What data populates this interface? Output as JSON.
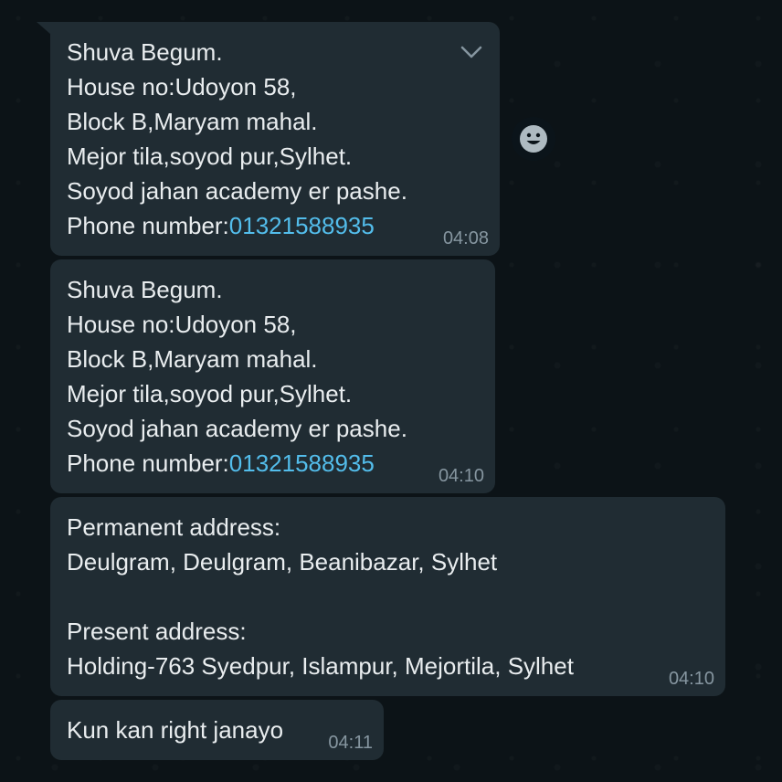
{
  "messages": [
    {
      "lines": [
        "Shuva Begum.",
        "House no:Udoyon 58,",
        "Block B,Maryam mahal.",
        "Mejor tila,soyod pur,Sylhet.",
        "Soyod jahan academy er pashe."
      ],
      "phone_label": "Phone number:",
      "phone": "01321588935",
      "time": "04:08"
    },
    {
      "lines": [
        "Shuva Begum.",
        "House no:Udoyon 58,",
        "Block B,Maryam mahal.",
        "Mejor tila,soyod pur,Sylhet.",
        "Soyod jahan academy er pashe."
      ],
      "phone_label": "Phone number:",
      "phone": "01321588935",
      "time": "04:10"
    },
    {
      "lines": [
        "Permanent address:",
        "Deulgram, Deulgram, Beanibazar, Sylhet",
        "",
        "Present address:",
        "Holding-763 Syedpur, Islampur, Mejortila, Sylhet"
      ],
      "time": "04:10"
    },
    {
      "lines": [
        "Kun kan right janayo"
      ],
      "time": "04:11"
    }
  ],
  "icons": {
    "menu": "chevron-down-icon",
    "react": "smiley-icon"
  },
  "colors": {
    "background": "#0c1317",
    "bubble": "#202c33",
    "text": "#e9edef",
    "link": "#53bdeb",
    "time": "#8696a0"
  }
}
